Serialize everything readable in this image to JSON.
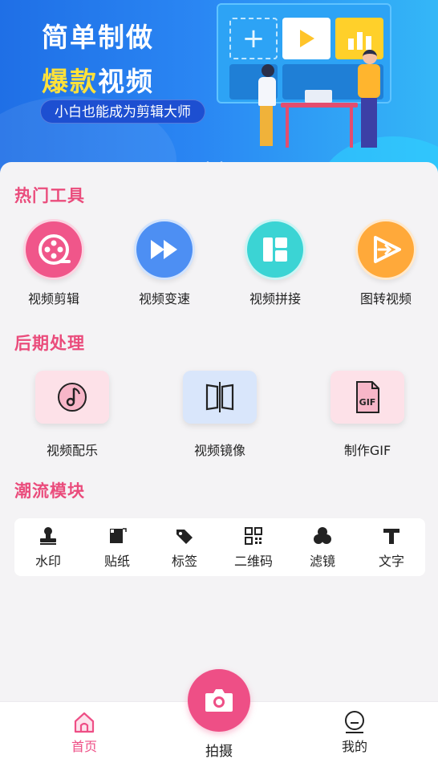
{
  "banner": {
    "title_line1": "简单制做",
    "title_line2_highlight": "爆款",
    "title_line2_rest": "视频",
    "subtitle": "小白也能成为剪辑大师"
  },
  "sections": {
    "hot_tools": "热门工具",
    "post_processing": "后期处理",
    "trend_modules": "潮流模块"
  },
  "hot_tools": [
    {
      "label": "视频剪辑",
      "icon": "film-reel-icon",
      "color": "#f0568a"
    },
    {
      "label": "视频变速",
      "icon": "fast-forward-icon",
      "color": "#4d8ff3"
    },
    {
      "label": "视频拼接",
      "icon": "layout-grid-icon",
      "color": "#3bd4d4"
    },
    {
      "label": "图转视频",
      "icon": "image-to-video-icon",
      "color": "#ffa93a"
    }
  ],
  "post_tools": [
    {
      "label": "视频配乐",
      "icon": "music-note-icon",
      "color": "#fde1e8"
    },
    {
      "label": "视频镜像",
      "icon": "mirror-icon",
      "color": "#d9e6fb"
    },
    {
      "label": "制作GIF",
      "icon": "gif-file-icon",
      "color": "#fde1e8"
    }
  ],
  "trend_items": [
    {
      "label": "水印",
      "icon": "stamp-icon"
    },
    {
      "label": "贴纸",
      "icon": "sticker-icon"
    },
    {
      "label": "标签",
      "icon": "tag-icon"
    },
    {
      "label": "二维码",
      "icon": "qr-code-icon"
    },
    {
      "label": "滤镜",
      "icon": "filter-icon"
    },
    {
      "label": "文字",
      "icon": "text-icon"
    }
  ],
  "tabbar": {
    "home": "首页",
    "shoot": "拍摄",
    "mine": "我的",
    "active_color": "#ee4f86"
  }
}
